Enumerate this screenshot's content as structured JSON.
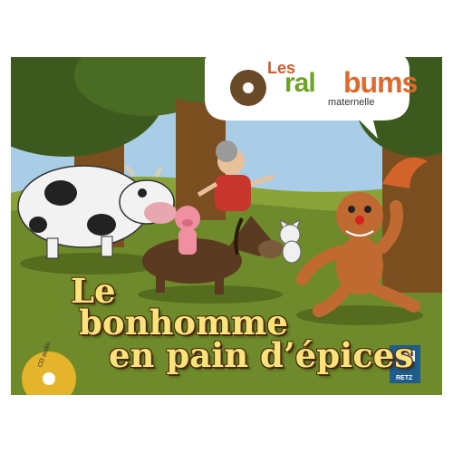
{
  "series_logo": {
    "les": "Les",
    "ral": "ral",
    "bums": "bums",
    "maternelle": "maternelle"
  },
  "title": {
    "line1": "Le",
    "line2": "bonhomme",
    "line3": "en pain d’épices"
  },
  "cd": {
    "label": "CD audio"
  },
  "publisher": {
    "name": "RETZ"
  },
  "colors": {
    "sky": "#a9cde6",
    "grass": "#6f8a2a",
    "title_fill": "#fbe27a",
    "title_outline": "#4a2a12",
    "logo_orange": "#e0682a",
    "logo_green": "#6da326"
  }
}
